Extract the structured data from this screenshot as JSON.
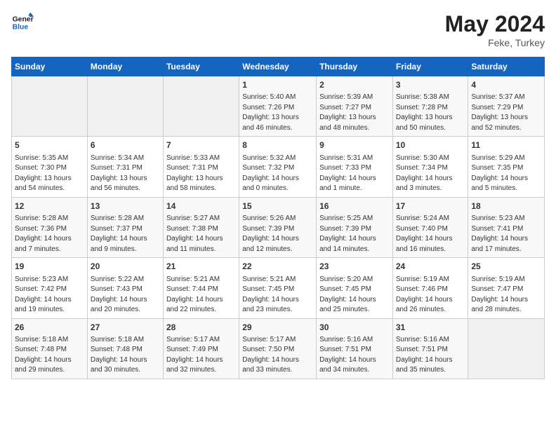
{
  "header": {
    "logo_line1": "General",
    "logo_line2": "Blue",
    "month_year": "May 2024",
    "location": "Feke, Turkey"
  },
  "weekdays": [
    "Sunday",
    "Monday",
    "Tuesday",
    "Wednesday",
    "Thursday",
    "Friday",
    "Saturday"
  ],
  "weeks": [
    [
      {
        "day": "",
        "info": ""
      },
      {
        "day": "",
        "info": ""
      },
      {
        "day": "",
        "info": ""
      },
      {
        "day": "1",
        "info": "Sunrise: 5:40 AM\nSunset: 7:26 PM\nDaylight: 13 hours\nand 46 minutes."
      },
      {
        "day": "2",
        "info": "Sunrise: 5:39 AM\nSunset: 7:27 PM\nDaylight: 13 hours\nand 48 minutes."
      },
      {
        "day": "3",
        "info": "Sunrise: 5:38 AM\nSunset: 7:28 PM\nDaylight: 13 hours\nand 50 minutes."
      },
      {
        "day": "4",
        "info": "Sunrise: 5:37 AM\nSunset: 7:29 PM\nDaylight: 13 hours\nand 52 minutes."
      }
    ],
    [
      {
        "day": "5",
        "info": "Sunrise: 5:35 AM\nSunset: 7:30 PM\nDaylight: 13 hours\nand 54 minutes."
      },
      {
        "day": "6",
        "info": "Sunrise: 5:34 AM\nSunset: 7:31 PM\nDaylight: 13 hours\nand 56 minutes."
      },
      {
        "day": "7",
        "info": "Sunrise: 5:33 AM\nSunset: 7:31 PM\nDaylight: 13 hours\nand 58 minutes."
      },
      {
        "day": "8",
        "info": "Sunrise: 5:32 AM\nSunset: 7:32 PM\nDaylight: 14 hours\nand 0 minutes."
      },
      {
        "day": "9",
        "info": "Sunrise: 5:31 AM\nSunset: 7:33 PM\nDaylight: 14 hours\nand 1 minute."
      },
      {
        "day": "10",
        "info": "Sunrise: 5:30 AM\nSunset: 7:34 PM\nDaylight: 14 hours\nand 3 minutes."
      },
      {
        "day": "11",
        "info": "Sunrise: 5:29 AM\nSunset: 7:35 PM\nDaylight: 14 hours\nand 5 minutes."
      }
    ],
    [
      {
        "day": "12",
        "info": "Sunrise: 5:28 AM\nSunset: 7:36 PM\nDaylight: 14 hours\nand 7 minutes."
      },
      {
        "day": "13",
        "info": "Sunrise: 5:28 AM\nSunset: 7:37 PM\nDaylight: 14 hours\nand 9 minutes."
      },
      {
        "day": "14",
        "info": "Sunrise: 5:27 AM\nSunset: 7:38 PM\nDaylight: 14 hours\nand 11 minutes."
      },
      {
        "day": "15",
        "info": "Sunrise: 5:26 AM\nSunset: 7:39 PM\nDaylight: 14 hours\nand 12 minutes."
      },
      {
        "day": "16",
        "info": "Sunrise: 5:25 AM\nSunset: 7:39 PM\nDaylight: 14 hours\nand 14 minutes."
      },
      {
        "day": "17",
        "info": "Sunrise: 5:24 AM\nSunset: 7:40 PM\nDaylight: 14 hours\nand 16 minutes."
      },
      {
        "day": "18",
        "info": "Sunrise: 5:23 AM\nSunset: 7:41 PM\nDaylight: 14 hours\nand 17 minutes."
      }
    ],
    [
      {
        "day": "19",
        "info": "Sunrise: 5:23 AM\nSunset: 7:42 PM\nDaylight: 14 hours\nand 19 minutes."
      },
      {
        "day": "20",
        "info": "Sunrise: 5:22 AM\nSunset: 7:43 PM\nDaylight: 14 hours\nand 20 minutes."
      },
      {
        "day": "21",
        "info": "Sunrise: 5:21 AM\nSunset: 7:44 PM\nDaylight: 14 hours\nand 22 minutes."
      },
      {
        "day": "22",
        "info": "Sunrise: 5:21 AM\nSunset: 7:45 PM\nDaylight: 14 hours\nand 23 minutes."
      },
      {
        "day": "23",
        "info": "Sunrise: 5:20 AM\nSunset: 7:45 PM\nDaylight: 14 hours\nand 25 minutes."
      },
      {
        "day": "24",
        "info": "Sunrise: 5:19 AM\nSunset: 7:46 PM\nDaylight: 14 hours\nand 26 minutes."
      },
      {
        "day": "25",
        "info": "Sunrise: 5:19 AM\nSunset: 7:47 PM\nDaylight: 14 hours\nand 28 minutes."
      }
    ],
    [
      {
        "day": "26",
        "info": "Sunrise: 5:18 AM\nSunset: 7:48 PM\nDaylight: 14 hours\nand 29 minutes."
      },
      {
        "day": "27",
        "info": "Sunrise: 5:18 AM\nSunset: 7:48 PM\nDaylight: 14 hours\nand 30 minutes."
      },
      {
        "day": "28",
        "info": "Sunrise: 5:17 AM\nSunset: 7:49 PM\nDaylight: 14 hours\nand 32 minutes."
      },
      {
        "day": "29",
        "info": "Sunrise: 5:17 AM\nSunset: 7:50 PM\nDaylight: 14 hours\nand 33 minutes."
      },
      {
        "day": "30",
        "info": "Sunrise: 5:16 AM\nSunset: 7:51 PM\nDaylight: 14 hours\nand 34 minutes."
      },
      {
        "day": "31",
        "info": "Sunrise: 5:16 AM\nSunset: 7:51 PM\nDaylight: 14 hours\nand 35 minutes."
      },
      {
        "day": "",
        "info": ""
      }
    ]
  ]
}
